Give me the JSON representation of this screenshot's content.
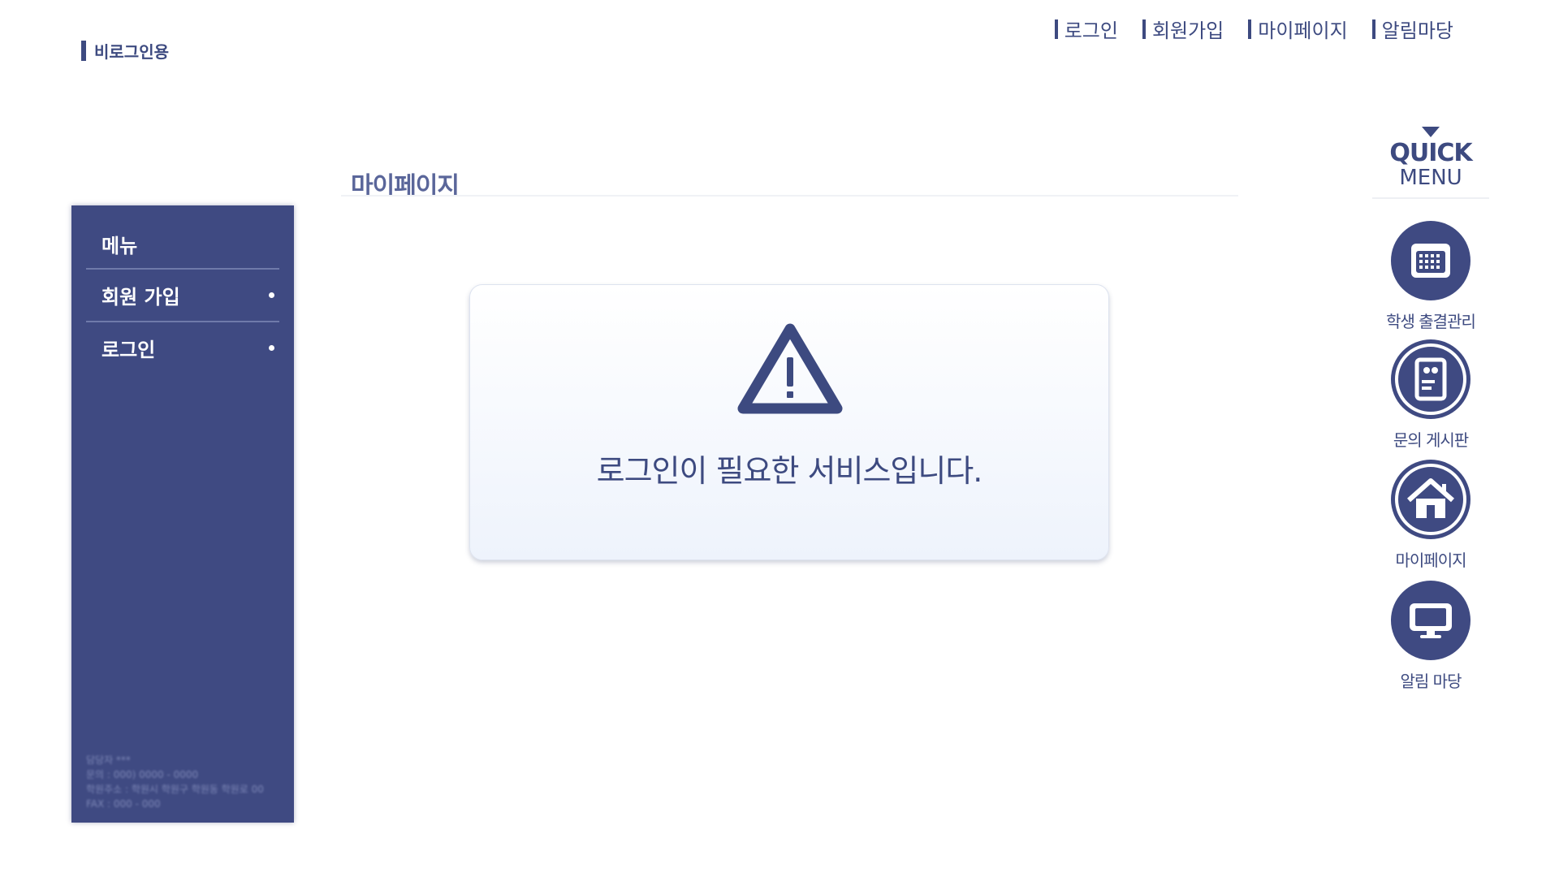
{
  "brand": {
    "label": "비로그인용"
  },
  "top_nav": [
    {
      "label": "로그인"
    },
    {
      "label": "회원가입"
    },
    {
      "label": "마이페이지"
    },
    {
      "label": "알림마당"
    }
  ],
  "sidebar": {
    "title": "메뉴",
    "items": [
      {
        "label": "회원 가입"
      },
      {
        "label": "로그인"
      }
    ],
    "footer": [
      "담당자 ***",
      "문의 : 000) 0000 - 0000",
      "학원주소 : 학원시 학원구 학원동 학원로 00",
      "FAX : 000 - 000"
    ]
  },
  "main": {
    "page_title": "마이페이지",
    "alert": {
      "icon": "warning-icon",
      "message": "로그인이 필요한 서비스입니다."
    }
  },
  "quick_menu": {
    "title_line1": "QUICK",
    "title_line2": "MENU",
    "items": [
      {
        "label": "학생 출결관리",
        "icon": "calendar-icon"
      },
      {
        "label": "문의 게시판",
        "icon": "document-quote-icon"
      },
      {
        "label": "마이페이지",
        "icon": "home-icon"
      },
      {
        "label": "알림 마당",
        "icon": "monitor-icon"
      }
    ]
  },
  "colors": {
    "primary": "#3f4a82",
    "text": "#3d4a80",
    "alert_bg": "#eef3fc"
  }
}
